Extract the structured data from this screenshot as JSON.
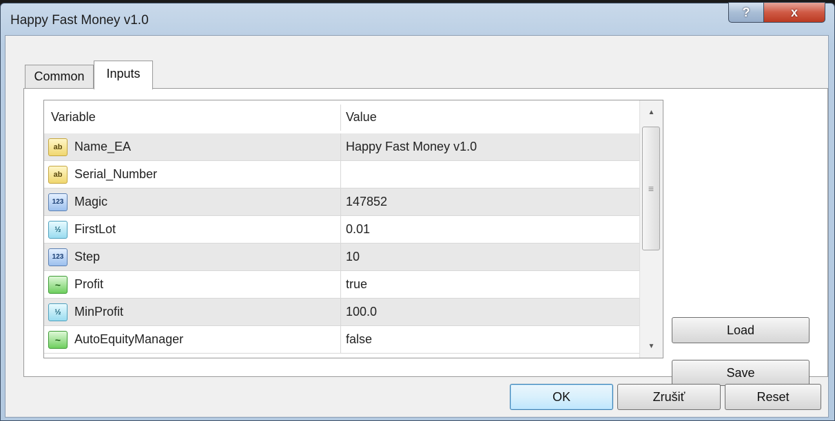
{
  "window": {
    "title": "Happy Fast Money v1.0",
    "help_label": "?",
    "close_label": "x"
  },
  "tabs": [
    {
      "label": "Common",
      "active": false
    },
    {
      "label": "Inputs",
      "active": true
    }
  ],
  "grid": {
    "headers": {
      "variable": "Variable",
      "value": "Value"
    },
    "rows": [
      {
        "icon": "string-icon",
        "icon_text": "ab",
        "variable": "Name_EA",
        "value": "Happy Fast Money v1.0"
      },
      {
        "icon": "string-icon",
        "icon_text": "ab",
        "variable": "Serial_Number",
        "value": ""
      },
      {
        "icon": "integer-icon",
        "icon_text": "123",
        "variable": "Magic",
        "value": "147852"
      },
      {
        "icon": "double-icon",
        "icon_text": "½",
        "variable": "FirstLot",
        "value": "0.01"
      },
      {
        "icon": "integer-icon",
        "icon_text": "123",
        "variable": "Step",
        "value": "10"
      },
      {
        "icon": "bool-icon",
        "icon_text": "~",
        "variable": "Profit",
        "value": "true"
      },
      {
        "icon": "double-icon",
        "icon_text": "½",
        "variable": "MinProfit",
        "value": "100.0"
      },
      {
        "icon": "bool-icon",
        "icon_text": "~",
        "variable": "AutoEquityManager",
        "value": "false"
      }
    ],
    "scroll_position": 0.0
  },
  "side_buttons": {
    "load": "Load",
    "save": "Save"
  },
  "footer_buttons": {
    "ok": "OK",
    "cancel": "Zrušiť",
    "reset": "Reset"
  },
  "colors": {
    "titlebar": "#b8cde3",
    "close": "#cf5a45",
    "row_alt": "#e8e8e8",
    "ok_border": "#3c7fb1"
  }
}
